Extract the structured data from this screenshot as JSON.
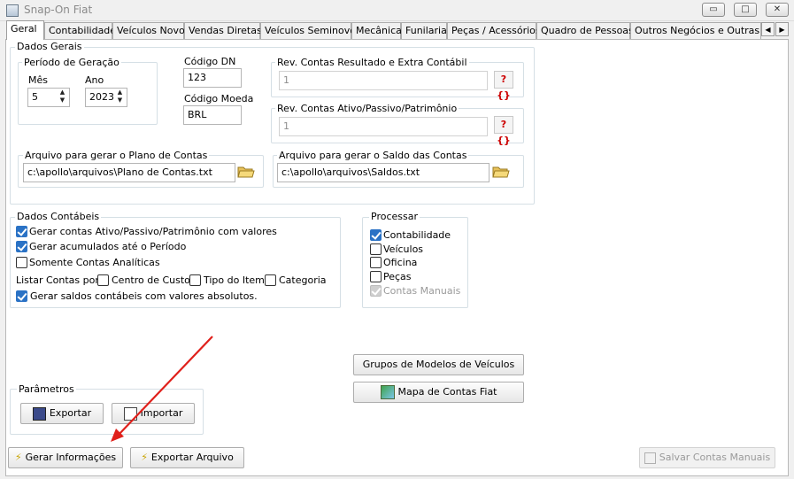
{
  "window": {
    "title": "Snap-On Fiat",
    "minimize": "▭",
    "maximize": "□",
    "close": "✕"
  },
  "tabs": [
    "Geral",
    "Contabilidade",
    "Veículos Novos",
    "Vendas Diretas",
    "Veículos Seminovos",
    "Mecânica",
    "Funilaria",
    "Peças / Acessórios",
    "Quadro de Pessoas",
    "Outros Negócios e Outras Mar"
  ],
  "tab_scroll": {
    "left": "◀",
    "right": "▶"
  },
  "dados_gerais": {
    "label": "Dados Gerais",
    "periodo": {
      "label": "Período de Geração",
      "mes_label": "Mês",
      "mes_value": "5",
      "ano_label": "Ano",
      "ano_value": "2023"
    },
    "codigo_dn_label": "Código DN",
    "codigo_dn_value": "123",
    "codigo_moeda_label": "Código Moeda",
    "codigo_moeda_value": "BRL",
    "rev_resultado": {
      "label": "Rev. Contas Resultado e Extra Contábil",
      "value": "1"
    },
    "rev_ativo": {
      "label": "Rev. Contas Ativo/Passivo/Patrimônio",
      "value": "1"
    },
    "arquivo_plano": {
      "label": "Arquivo para gerar o Plano de Contas",
      "value": "c:\\apollo\\arquivos\\Plano de Contas.txt"
    },
    "arquivo_saldo": {
      "label": "Arquivo para gerar o Saldo das Contas",
      "value": "c:\\apollo\\arquivos\\Saldos.txt"
    }
  },
  "dados_contabeis": {
    "label": "Dados Contábeis",
    "gerar_contas": "Gerar contas Ativo/Passivo/Patrimônio com valores",
    "gerar_acumulados": "Gerar acumulados até o Período",
    "somente_analiticas": "Somente Contas Analíticas",
    "listar_por": "Listar Contas por:",
    "centro_custo": "Centro de Custo",
    "tipo_item": "Tipo do Item",
    "categoria": "Categoria",
    "saldos_absolutos": "Gerar saldos contábeis com valores absolutos."
  },
  "processar": {
    "label": "Processar",
    "contabilidade": "Contabilidade",
    "veiculos": "Veículos",
    "oficina": "Oficina",
    "pecas": "Peças",
    "contas_manuais": "Contas Manuais"
  },
  "buttons": {
    "grupos_modelos": "Grupos de Modelos de Veículos",
    "mapa_contas": "Mapa de Contas Fiat",
    "parametros_label": "Parâmetros",
    "exportar": "Exportar",
    "importar": "Importar",
    "gerar_informacoes": "Gerar Informações",
    "exportar_arquivo": "Exportar Arquivo",
    "salvar_manuais": "Salvar Contas Manuais"
  },
  "annotation_color": "#e0201b"
}
